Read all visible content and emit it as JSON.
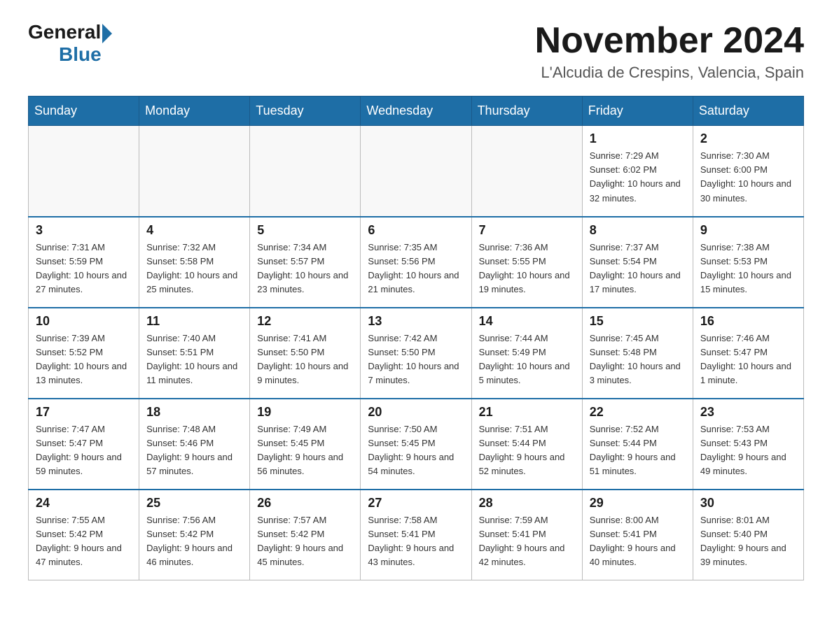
{
  "logo": {
    "general": "General",
    "blue": "Blue"
  },
  "header": {
    "month_year": "November 2024",
    "location": "L'Alcudia de Crespins, Valencia, Spain"
  },
  "weekdays": [
    "Sunday",
    "Monday",
    "Tuesday",
    "Wednesday",
    "Thursday",
    "Friday",
    "Saturday"
  ],
  "weeks": [
    [
      {
        "day": "",
        "empty": true
      },
      {
        "day": "",
        "empty": true
      },
      {
        "day": "",
        "empty": true
      },
      {
        "day": "",
        "empty": true
      },
      {
        "day": "",
        "empty": true
      },
      {
        "day": "1",
        "sunrise": "7:29 AM",
        "sunset": "6:02 PM",
        "daylight": "10 hours and 32 minutes."
      },
      {
        "day": "2",
        "sunrise": "7:30 AM",
        "sunset": "6:00 PM",
        "daylight": "10 hours and 30 minutes."
      }
    ],
    [
      {
        "day": "3",
        "sunrise": "7:31 AM",
        "sunset": "5:59 PM",
        "daylight": "10 hours and 27 minutes."
      },
      {
        "day": "4",
        "sunrise": "7:32 AM",
        "sunset": "5:58 PM",
        "daylight": "10 hours and 25 minutes."
      },
      {
        "day": "5",
        "sunrise": "7:34 AM",
        "sunset": "5:57 PM",
        "daylight": "10 hours and 23 minutes."
      },
      {
        "day": "6",
        "sunrise": "7:35 AM",
        "sunset": "5:56 PM",
        "daylight": "10 hours and 21 minutes."
      },
      {
        "day": "7",
        "sunrise": "7:36 AM",
        "sunset": "5:55 PM",
        "daylight": "10 hours and 19 minutes."
      },
      {
        "day": "8",
        "sunrise": "7:37 AM",
        "sunset": "5:54 PM",
        "daylight": "10 hours and 17 minutes."
      },
      {
        "day": "9",
        "sunrise": "7:38 AM",
        "sunset": "5:53 PM",
        "daylight": "10 hours and 15 minutes."
      }
    ],
    [
      {
        "day": "10",
        "sunrise": "7:39 AM",
        "sunset": "5:52 PM",
        "daylight": "10 hours and 13 minutes."
      },
      {
        "day": "11",
        "sunrise": "7:40 AM",
        "sunset": "5:51 PM",
        "daylight": "10 hours and 11 minutes."
      },
      {
        "day": "12",
        "sunrise": "7:41 AM",
        "sunset": "5:50 PM",
        "daylight": "10 hours and 9 minutes."
      },
      {
        "day": "13",
        "sunrise": "7:42 AM",
        "sunset": "5:50 PM",
        "daylight": "10 hours and 7 minutes."
      },
      {
        "day": "14",
        "sunrise": "7:44 AM",
        "sunset": "5:49 PM",
        "daylight": "10 hours and 5 minutes."
      },
      {
        "day": "15",
        "sunrise": "7:45 AM",
        "sunset": "5:48 PM",
        "daylight": "10 hours and 3 minutes."
      },
      {
        "day": "16",
        "sunrise": "7:46 AM",
        "sunset": "5:47 PM",
        "daylight": "10 hours and 1 minute."
      }
    ],
    [
      {
        "day": "17",
        "sunrise": "7:47 AM",
        "sunset": "5:47 PM",
        "daylight": "9 hours and 59 minutes."
      },
      {
        "day": "18",
        "sunrise": "7:48 AM",
        "sunset": "5:46 PM",
        "daylight": "9 hours and 57 minutes."
      },
      {
        "day": "19",
        "sunrise": "7:49 AM",
        "sunset": "5:45 PM",
        "daylight": "9 hours and 56 minutes."
      },
      {
        "day": "20",
        "sunrise": "7:50 AM",
        "sunset": "5:45 PM",
        "daylight": "9 hours and 54 minutes."
      },
      {
        "day": "21",
        "sunrise": "7:51 AM",
        "sunset": "5:44 PM",
        "daylight": "9 hours and 52 minutes."
      },
      {
        "day": "22",
        "sunrise": "7:52 AM",
        "sunset": "5:44 PM",
        "daylight": "9 hours and 51 minutes."
      },
      {
        "day": "23",
        "sunrise": "7:53 AM",
        "sunset": "5:43 PM",
        "daylight": "9 hours and 49 minutes."
      }
    ],
    [
      {
        "day": "24",
        "sunrise": "7:55 AM",
        "sunset": "5:42 PM",
        "daylight": "9 hours and 47 minutes."
      },
      {
        "day": "25",
        "sunrise": "7:56 AM",
        "sunset": "5:42 PM",
        "daylight": "9 hours and 46 minutes."
      },
      {
        "day": "26",
        "sunrise": "7:57 AM",
        "sunset": "5:42 PM",
        "daylight": "9 hours and 45 minutes."
      },
      {
        "day": "27",
        "sunrise": "7:58 AM",
        "sunset": "5:41 PM",
        "daylight": "9 hours and 43 minutes."
      },
      {
        "day": "28",
        "sunrise": "7:59 AM",
        "sunset": "5:41 PM",
        "daylight": "9 hours and 42 minutes."
      },
      {
        "day": "29",
        "sunrise": "8:00 AM",
        "sunset": "5:41 PM",
        "daylight": "9 hours and 40 minutes."
      },
      {
        "day": "30",
        "sunrise": "8:01 AM",
        "sunset": "5:40 PM",
        "daylight": "9 hours and 39 minutes."
      }
    ]
  ]
}
